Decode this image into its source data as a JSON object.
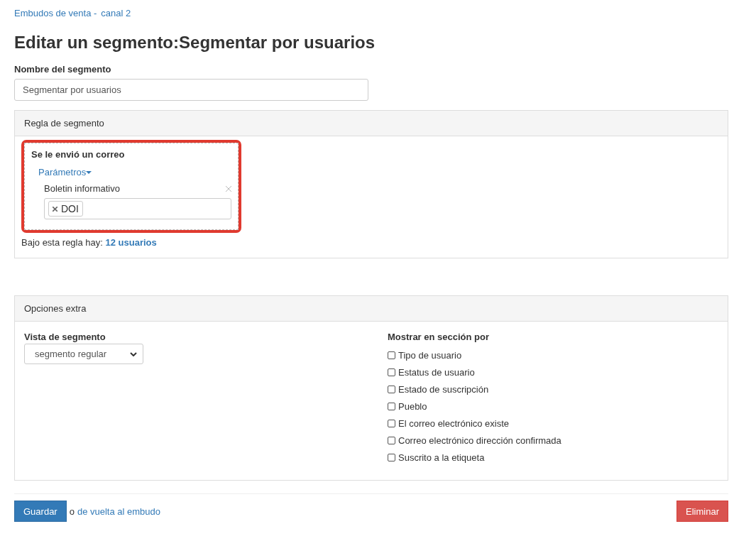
{
  "breadcrumb": [
    "Embudos de venta -",
    "canal 2"
  ],
  "title": "Editar un segmento:Segmentar por usuarios",
  "name_field": {
    "label": "Nombre del segmento",
    "value": "Segmentar por usuarios"
  },
  "rule_panel": {
    "heading": "Regla de segmento",
    "condition": {
      "title": "Se le envió un correo",
      "highlighted": true,
      "params_toggle": "Parámetros",
      "param_label": "Boletin informativo",
      "tags": [
        "DOI"
      ]
    },
    "count_prefix": "Bajo esta regla hay:",
    "count_link": "12 usuarios"
  },
  "extra_panel": {
    "heading": "Opciones extra",
    "view": {
      "label": "Vista de segmento",
      "value": "segmento regular"
    },
    "show_by": {
      "label": "Mostrar en sección por",
      "options": [
        {
          "label": "Tipo de usuario",
          "checked": false
        },
        {
          "label": "Estatus de usuario",
          "checked": false
        },
        {
          "label": "Estado de suscripción",
          "checked": false
        },
        {
          "label": "Pueblo",
          "checked": false
        },
        {
          "label": "El correo electrónico existe",
          "checked": false
        },
        {
          "label": "Correo electrónico dirección confirmada",
          "checked": false
        },
        {
          "label": "Suscrito a la etiqueta",
          "checked": false
        }
      ]
    }
  },
  "footer": {
    "save": "Guardar",
    "or_text": "o",
    "back_link": "de vuelta al embudo",
    "delete": "Eliminar"
  }
}
